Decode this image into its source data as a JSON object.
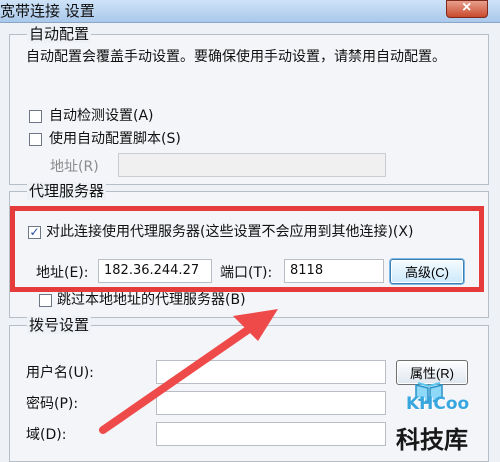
{
  "window": {
    "title": "宽带连接 设置",
    "close_label": "×"
  },
  "auto_config": {
    "title": "自动配置",
    "description": "自动配置会覆盖手动设置。要确保使用手动设置，请禁用自动配置。",
    "detect_label": "自动检测设置(A)",
    "script_label": "使用自动配置脚本(S)",
    "address_label": "地址(R)",
    "address_value": ""
  },
  "proxy": {
    "title": "代理服务器",
    "use_proxy_label": "对此连接使用代理服务器(这些设置不会应用到其他连接)(X)",
    "address_label": "地址(E):",
    "address_value": "182.36.244.27",
    "port_label": "端口(T):",
    "port_value": "8118",
    "advanced_label": "高级(C)",
    "bypass_label": "跳过本地地址的代理服务器(B)",
    "checked_mark": "✓"
  },
  "dialup": {
    "title": "拨号设置",
    "username_label": "用户名(U):",
    "username_value": "",
    "password_label": "密码(P):",
    "password_value": "",
    "domain_label": "域(D):",
    "domain_value": "",
    "properties_label": "属性(R)"
  },
  "watermark": {
    "brand": "KHCoo",
    "subtitle": "科技库"
  },
  "colors": {
    "highlight": "#e53b3b",
    "checkbox": "#244ea6",
    "watermark": "#38a6df"
  },
  "icons": {
    "close": "close-icon",
    "checkbox": "checkbox-icon",
    "arrow": "red-arrow-icon",
    "logo": "book-logo-icon"
  }
}
